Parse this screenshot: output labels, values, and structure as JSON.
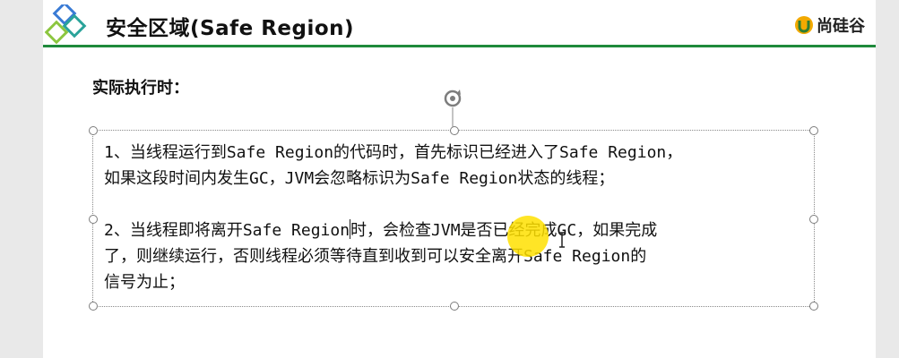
{
  "slide": {
    "title": "安全区域(Safe Region)",
    "brand": "尚硅谷",
    "subtitle": "实际执行时：",
    "paragraph1": {
      "line1": "1、当线程运行到Safe Region的代码时，首先标识已经进入了Safe Region，",
      "line2": "如果这段时间内发生GC，JVM会忽略标识为Safe Region状态的线程；"
    },
    "paragraph2": {
      "line1_a": "2、当线程即将离开Safe Region",
      "line1_b": "时，会检查JVM是否已经完成GC，如果完成",
      "line2": "了，则继续运行，否则线程必须等待直到收到可以安全离开Safe Region的",
      "line3": "信号为止；"
    }
  },
  "colors": {
    "accent_green": "#1f8a3b",
    "logo_blue": "#3a7bd5",
    "logo_teal": "#2aa39a",
    "highlight_yellow": "#ffe100"
  },
  "icons": {
    "logo": "diamond-logo-icon",
    "brand": "atguigu-logo-icon",
    "rotate": "rotate-handle-icon",
    "cursor": "text-cursor-icon"
  }
}
